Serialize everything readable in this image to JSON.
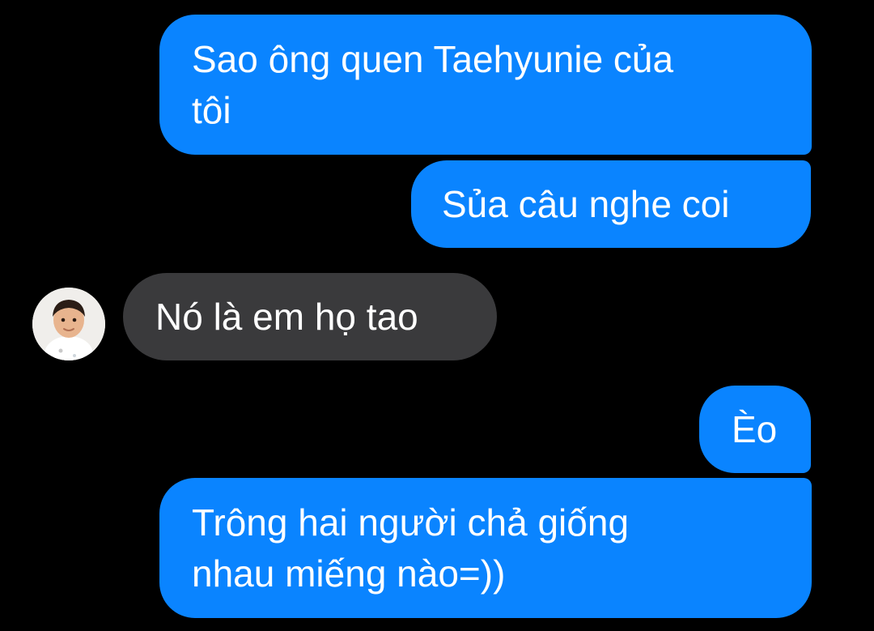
{
  "messages": [
    {
      "side": "out",
      "text": "Sao ông quen Taehyunie của\ntôi"
    },
    {
      "side": "out",
      "text": "Sủa câu nghe coi"
    },
    {
      "side": "in",
      "text": "Nó là em họ tao",
      "avatar_icon": "child-avatar-icon"
    },
    {
      "side": "out",
      "text": "Èo"
    },
    {
      "side": "out",
      "text": "Trông hai người chả giống\nnhau miếng nào=))"
    }
  ],
  "colors": {
    "background": "#000000",
    "outgoing_bubble": "#0a84ff",
    "incoming_bubble": "#3a3a3c",
    "text": "#ffffff"
  }
}
